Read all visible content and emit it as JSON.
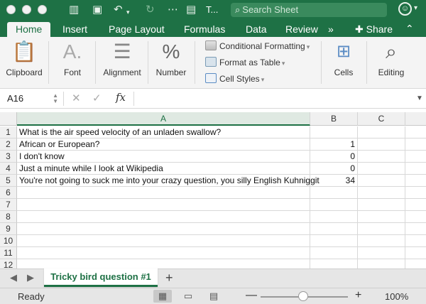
{
  "window": {
    "title": "T...",
    "search_placeholder": "Search Sheet"
  },
  "tabs": [
    "Home",
    "Insert",
    "Page Layout",
    "Formulas",
    "Data",
    "Review"
  ],
  "more_tabs": "»",
  "share_label": "Share",
  "ribbon": {
    "clipboard": "Clipboard",
    "font": "Font",
    "alignment": "Alignment",
    "number": "Number",
    "conditional_formatting": "Conditional Formatting",
    "format_as_table": "Format as Table",
    "cell_styles": "Cell Styles",
    "cells": "Cells",
    "editing": "Editing"
  },
  "formula_bar": {
    "name_box": "A16",
    "fx": "fx",
    "content": ""
  },
  "columns": [
    "A",
    "B",
    "C"
  ],
  "rows": [
    {
      "num": "1",
      "a": "What is the air speed velocity of an unladen swallow?",
      "b": ""
    },
    {
      "num": "2",
      "a": "African or European?",
      "b": "1"
    },
    {
      "num": "3",
      "a": "I don't know",
      "b": "0"
    },
    {
      "num": "4",
      "a": "Just a minute while I look at Wikipedia",
      "b": "0"
    },
    {
      "num": "5",
      "a": "You're not going to suck me into your crazy question, you silly English Kuhniggit",
      "b": "34"
    },
    {
      "num": "6",
      "a": "",
      "b": ""
    },
    {
      "num": "7",
      "a": "",
      "b": ""
    },
    {
      "num": "8",
      "a": "",
      "b": ""
    },
    {
      "num": "9",
      "a": "",
      "b": ""
    },
    {
      "num": "10",
      "a": "",
      "b": ""
    },
    {
      "num": "11",
      "a": "",
      "b": ""
    },
    {
      "num": "12",
      "a": "",
      "b": ""
    }
  ],
  "sheet_tab": "Tricky bird question #1",
  "status": {
    "ready": "Ready",
    "zoom": "100%"
  },
  "colors": {
    "accent": "#1e7145"
  }
}
